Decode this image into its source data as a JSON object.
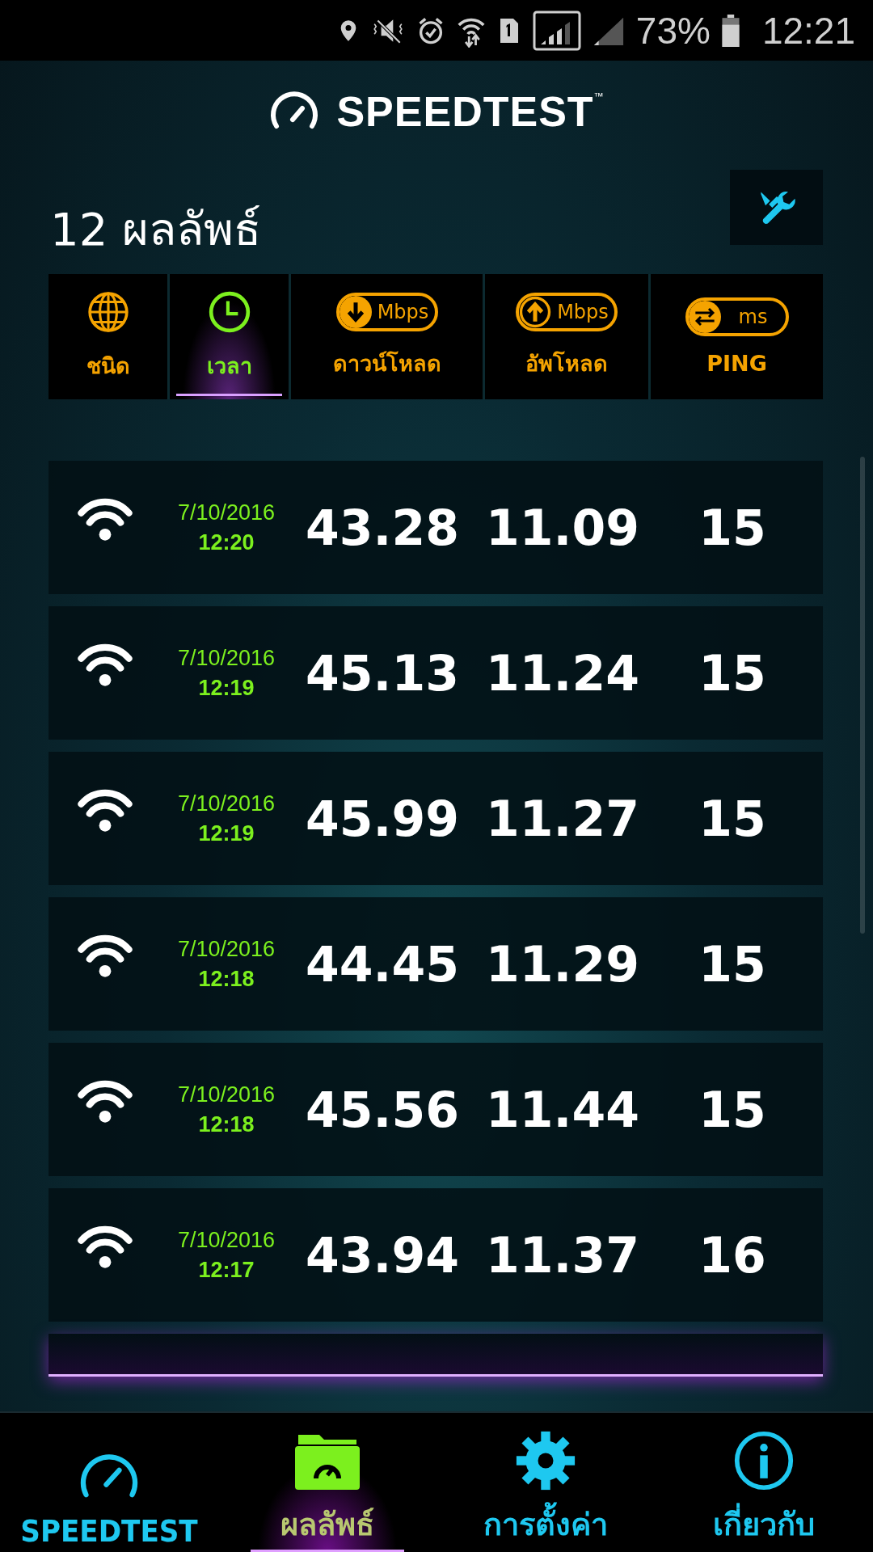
{
  "status_bar": {
    "battery": "73%",
    "time": "12:21"
  },
  "header": {
    "logo": "SPEEDTEST",
    "trademark": "™"
  },
  "results": {
    "title": "12 ผลลัพธ์"
  },
  "sort_columns": [
    {
      "kind": "type",
      "label": "ชนิด",
      "selected": false
    },
    {
      "kind": "time",
      "label": "เวลา",
      "selected": true
    },
    {
      "kind": "download",
      "label": "ดาวน์โหลด",
      "unit": "Mbps",
      "selected": false
    },
    {
      "kind": "upload",
      "label": "อัพโหลด",
      "unit": "Mbps",
      "selected": false
    },
    {
      "kind": "ping",
      "label": "PING",
      "unit": "ms",
      "selected": false
    }
  ],
  "rows": [
    {
      "kind": "wifi",
      "date": "7/10/2016",
      "time": "12:20",
      "download": "43.28",
      "upload": "11.09",
      "ping": "15"
    },
    {
      "kind": "wifi",
      "date": "7/10/2016",
      "time": "12:19",
      "download": "45.13",
      "upload": "11.24",
      "ping": "15"
    },
    {
      "kind": "wifi",
      "date": "7/10/2016",
      "time": "12:19",
      "download": "45.99",
      "upload": "11.27",
      "ping": "15"
    },
    {
      "kind": "wifi",
      "date": "7/10/2016",
      "time": "12:18",
      "download": "44.45",
      "upload": "11.29",
      "ping": "15"
    },
    {
      "kind": "wifi",
      "date": "7/10/2016",
      "time": "12:18",
      "download": "45.56",
      "upload": "11.44",
      "ping": "15"
    },
    {
      "kind": "wifi",
      "date": "7/10/2016",
      "time": "12:17",
      "download": "43.94",
      "upload": "11.37",
      "ping": "16"
    }
  ],
  "bottom_nav": [
    {
      "kind": "speedtest",
      "label": "SPEEDTEST",
      "selected": false
    },
    {
      "kind": "results",
      "label": "ผลลัพธ์",
      "selected": true
    },
    {
      "kind": "settings",
      "label": "การตั้งค่า",
      "selected": false
    },
    {
      "kind": "about",
      "label": "เกี่ยวกับ",
      "selected": false
    }
  ]
}
